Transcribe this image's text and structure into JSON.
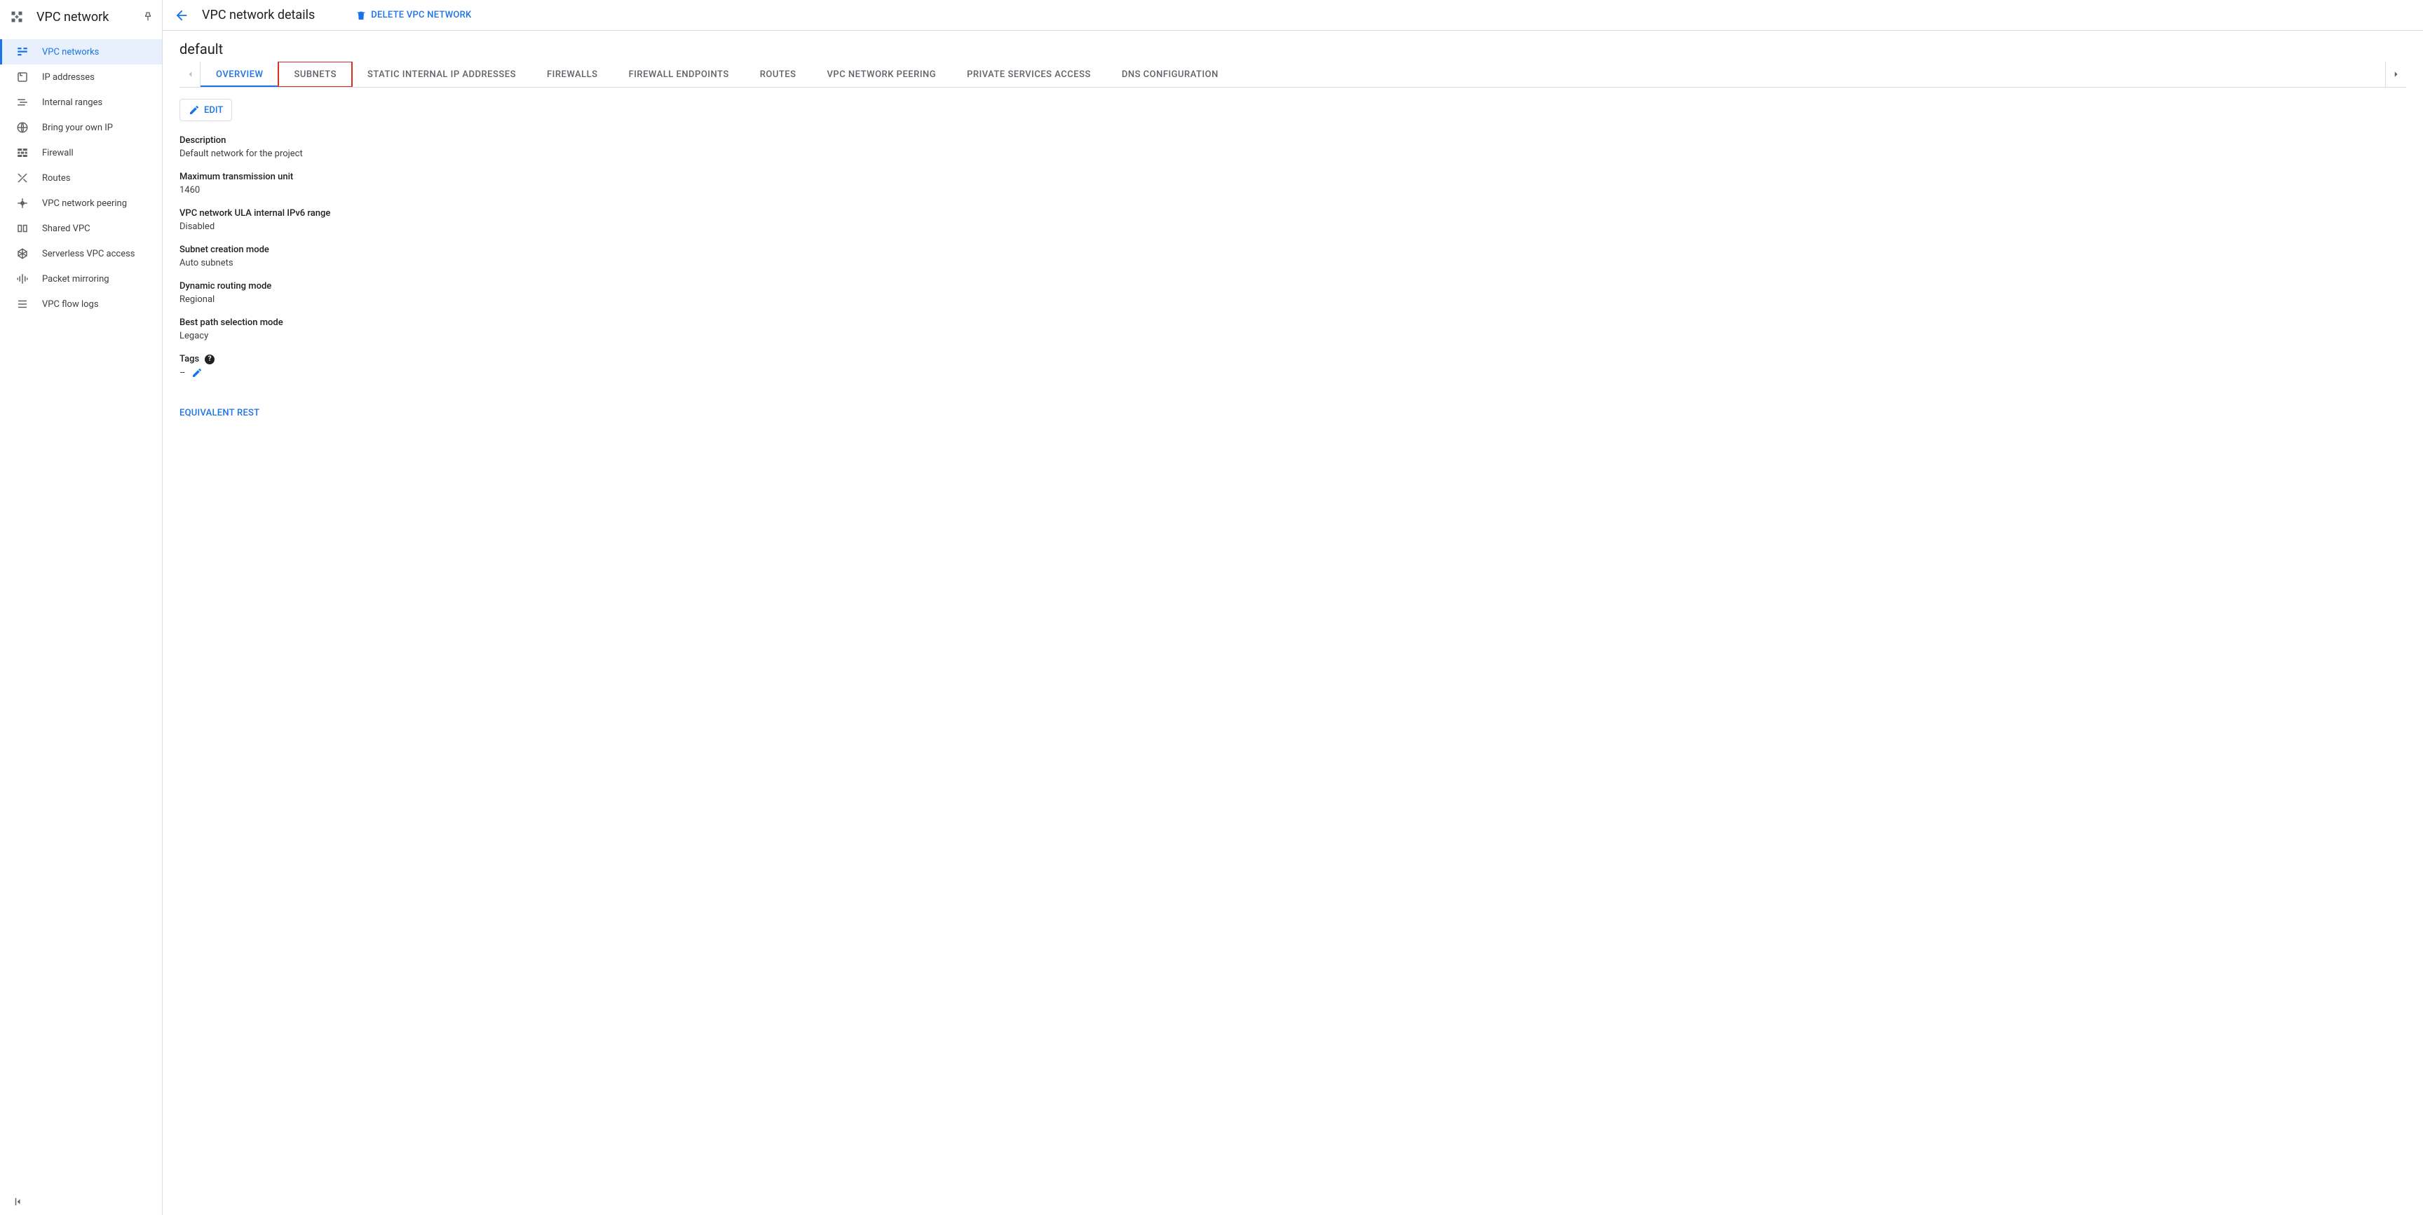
{
  "sidebar": {
    "title": "VPC network",
    "items": [
      {
        "label": "VPC networks",
        "icon": "vpc-networks-icon",
        "selected": true
      },
      {
        "label": "IP addresses",
        "icon": "ip-addresses-icon",
        "selected": false
      },
      {
        "label": "Internal ranges",
        "icon": "internal-ranges-icon",
        "selected": false
      },
      {
        "label": "Bring your own IP",
        "icon": "byoip-icon",
        "selected": false
      },
      {
        "label": "Firewall",
        "icon": "firewall-icon",
        "selected": false
      },
      {
        "label": "Routes",
        "icon": "routes-icon",
        "selected": false
      },
      {
        "label": "VPC network peering",
        "icon": "peering-icon",
        "selected": false
      },
      {
        "label": "Shared VPC",
        "icon": "shared-vpc-icon",
        "selected": false
      },
      {
        "label": "Serverless VPC access",
        "icon": "serverless-icon",
        "selected": false
      },
      {
        "label": "Packet mirroring",
        "icon": "mirroring-icon",
        "selected": false
      },
      {
        "label": "VPC flow logs",
        "icon": "flow-logs-icon",
        "selected": false
      }
    ]
  },
  "topbar": {
    "page_title": "VPC network details",
    "delete_label": "DELETE VPC NETWORK"
  },
  "network_name": "default",
  "tabs": [
    {
      "label": "OVERVIEW",
      "active": true,
      "highlighted": false
    },
    {
      "label": "SUBNETS",
      "active": false,
      "highlighted": true
    },
    {
      "label": "STATIC INTERNAL IP ADDRESSES",
      "active": false,
      "highlighted": false
    },
    {
      "label": "FIREWALLS",
      "active": false,
      "highlighted": false
    },
    {
      "label": "FIREWALL ENDPOINTS",
      "active": false,
      "highlighted": false
    },
    {
      "label": "ROUTES",
      "active": false,
      "highlighted": false
    },
    {
      "label": "VPC NETWORK PEERING",
      "active": false,
      "highlighted": false
    },
    {
      "label": "PRIVATE SERVICES ACCESS",
      "active": false,
      "highlighted": false
    },
    {
      "label": "DNS CONFIGURATION",
      "active": false,
      "highlighted": false
    }
  ],
  "edit_label": "EDIT",
  "details": {
    "description": {
      "label": "Description",
      "value": "Default network for the project"
    },
    "mtu": {
      "label": "Maximum transmission unit",
      "value": "1460"
    },
    "ula": {
      "label": "VPC network ULA internal IPv6 range",
      "value": "Disabled"
    },
    "subnet_mode": {
      "label": "Subnet creation mode",
      "value": "Auto subnets"
    },
    "routing_mode": {
      "label": "Dynamic routing mode",
      "value": "Regional"
    },
    "best_path": {
      "label": "Best path selection mode",
      "value": "Legacy"
    },
    "tags": {
      "label": "Tags",
      "value": "–"
    }
  },
  "rest_link_label": "EQUIVALENT REST"
}
